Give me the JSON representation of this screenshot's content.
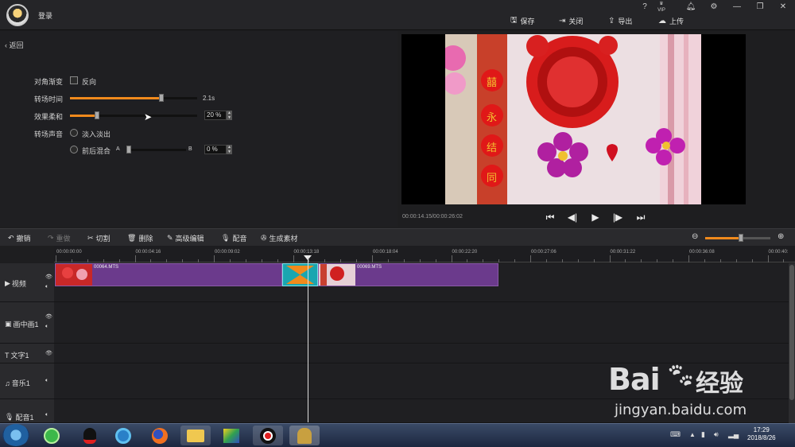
{
  "titlebar": {
    "login": "登录",
    "buttons": {
      "save": "保存",
      "close": "关闭",
      "export": "导出",
      "upload": "上传"
    },
    "window_controls": {
      "help": "?",
      "vip": "VIP"
    }
  },
  "left_panel": {
    "back": "返回",
    "diagonal_label": "对角渐变",
    "reverse_label": "反向",
    "transition_time_label": "转场时间",
    "transition_time_value": "2.1s",
    "transition_time_fraction": 0.72,
    "softness_label": "效果柔和",
    "softness_value": "20 %",
    "softness_fraction": 0.2,
    "sound_label": "转场声音",
    "fade_label": "淡入淡出",
    "mix_label": "前后混合",
    "mix_a": "A",
    "mix_b": "B",
    "mix_value": "0 %",
    "mix_fraction": 0.0
  },
  "preview": {
    "timecode": "00:00:14.15/00:00:26:02",
    "photo_chars": [
      "囍",
      "永",
      "结",
      "同"
    ]
  },
  "toolbar": {
    "undo": "撤销",
    "redo": "重做",
    "cut": "切割",
    "delete": "删除",
    "advanced": "高级编辑",
    "dub": "配音",
    "generate": "生成素材",
    "zoom_fraction": 0.55
  },
  "ruler": {
    "ticks": [
      "00:00:00:00",
      "00:00:04:16",
      "00:00:09:02",
      "00:00:13:18",
      "00:00:18:04",
      "00:00:22:20",
      "00:00:27:06",
      "00:00:31:22",
      "00:00:36:08",
      "00:00:40:"
    ]
  },
  "tracks": {
    "video": "视频",
    "pip": "画中画1",
    "text": "文字1",
    "music": "音乐1",
    "voice": "配音1",
    "clip1": "00064.MTS",
    "clip2": "00069.MTS"
  },
  "taskbar": {
    "time": "17:29",
    "date": "2018/8/26"
  },
  "watermark": {
    "brand": "Bai",
    "brand2": "经验",
    "url": "jingyan.baidu.com"
  },
  "colors": {
    "accent": "#f08a1c",
    "clip": "#6b3a8c",
    "bg": "#1e1e20"
  }
}
